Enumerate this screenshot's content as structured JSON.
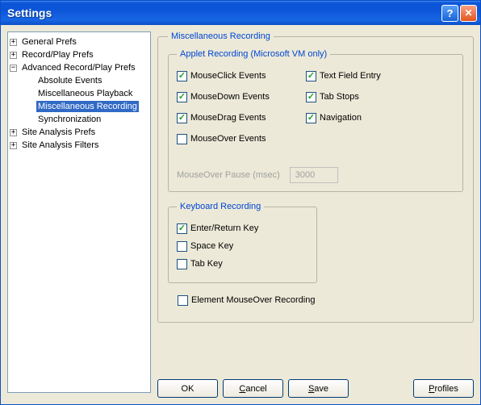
{
  "window": {
    "title": "Settings"
  },
  "tree": {
    "general": "General Prefs",
    "recordplay": "Record/Play Prefs",
    "advanced": "Advanced Record/Play Prefs",
    "absolute": "Absolute Events",
    "miscplay": "Miscellaneous Playback",
    "miscrec": "Miscellaneous Recording",
    "sync": "Synchronization",
    "siteprefs": "Site Analysis Prefs",
    "sitefilters": "Site Analysis Filters"
  },
  "group": {
    "main_title": "Miscellaneous Recording",
    "applet_title": "Applet Recording (Microsoft VM only)",
    "keyboard_title": "Keyboard Recording"
  },
  "checks": {
    "mouseclick": "MouseClick Events",
    "mousedown": "MouseDown Events",
    "mousedrag": "MouseDrag Events",
    "mouseover": "MouseOver Events",
    "textfield": "Text Field Entry",
    "tabstops": "Tab Stops",
    "navigation": "Navigation",
    "enter": "Enter/Return Key",
    "space": "Space Key",
    "tab": "Tab Key",
    "element_mouseover": "Element MouseOver Recording"
  },
  "states": {
    "mouseclick": true,
    "mousedown": true,
    "mousedrag": true,
    "mouseover": false,
    "textfield": true,
    "tabstops": true,
    "navigation": true,
    "enter": true,
    "space": false,
    "tab": false,
    "element_mouseover": false
  },
  "pause": {
    "label": "MouseOver Pause (msec)",
    "value": "3000"
  },
  "buttons": {
    "ok": "OK",
    "cancel": "Cancel",
    "save": "Save",
    "profiles": "Profiles"
  }
}
